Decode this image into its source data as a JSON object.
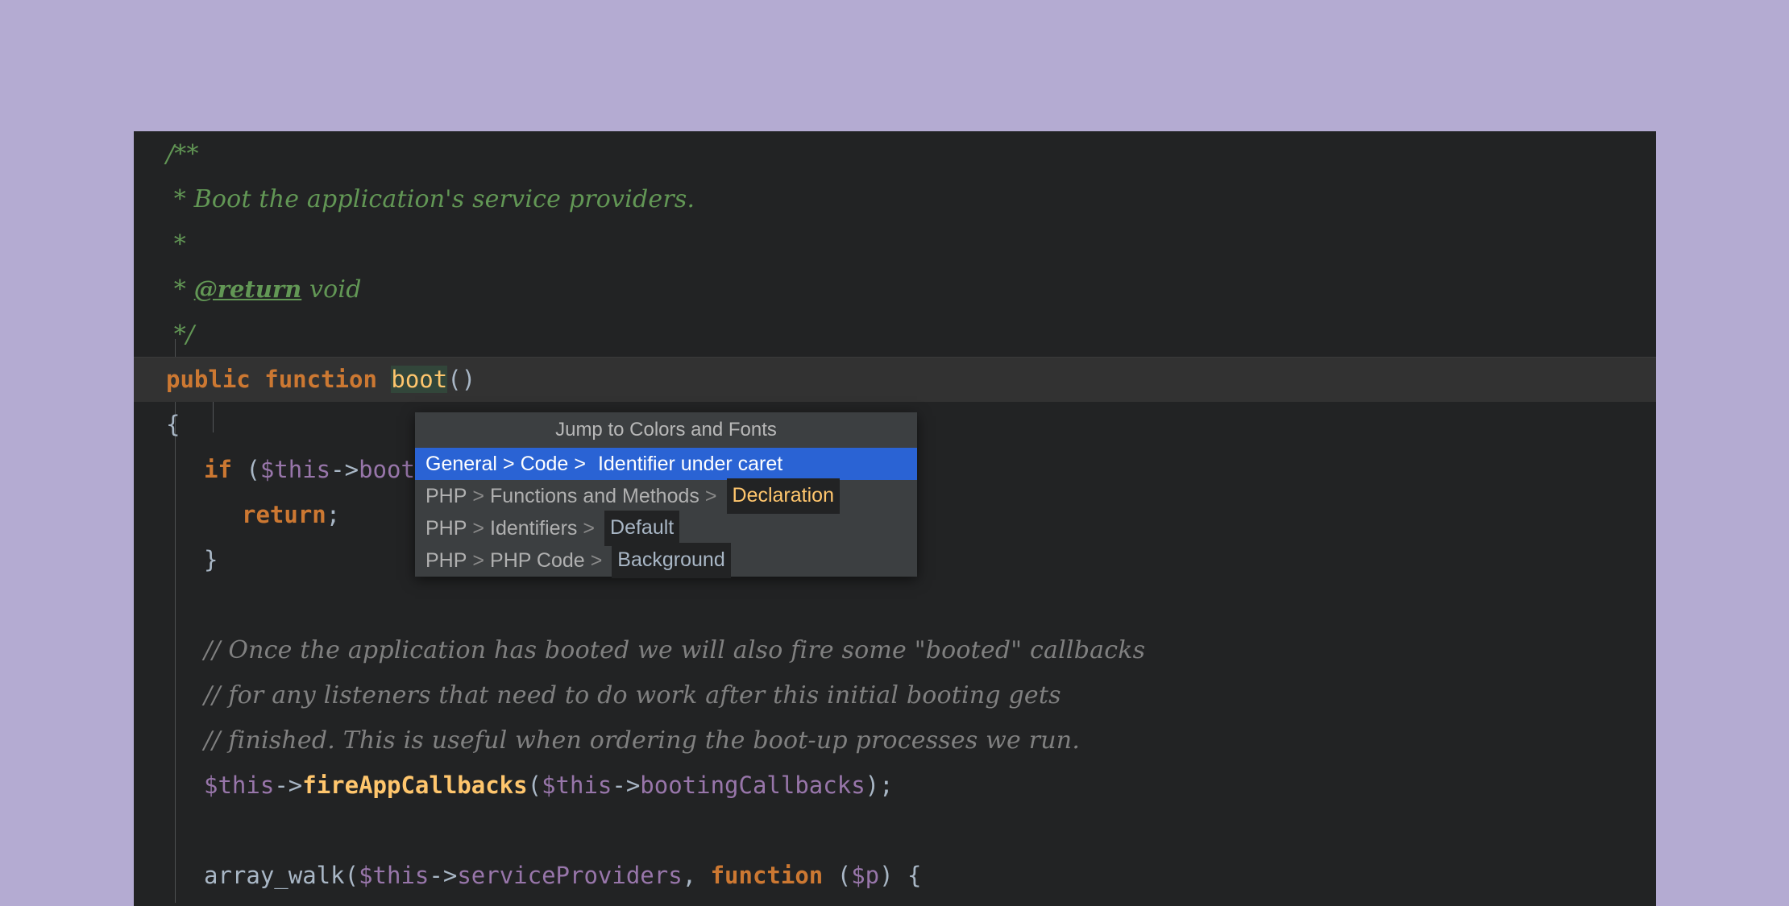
{
  "window": {
    "background_color": "#b4abd2",
    "editor_background": "#222324",
    "caret_line_background": "#323232"
  },
  "editor": {
    "lines": [
      {
        "id": "l1",
        "indent": 0,
        "type": "doc",
        "text": "/**"
      },
      {
        "id": "l2",
        "indent": 0,
        "type": "doc",
        "text": " * Boot the application's service providers."
      },
      {
        "id": "l3",
        "indent": 0,
        "type": "doc",
        "text": " *"
      },
      {
        "id": "l4",
        "indent": 0,
        "type": "doc",
        "prefix": " * ",
        "tag": "@return",
        "suffix": " void"
      },
      {
        "id": "l5",
        "indent": 0,
        "type": "doc",
        "text": " */"
      },
      {
        "id": "l6",
        "indent": 0,
        "type": "code",
        "caret": true,
        "tokens": [
          {
            "t": "public",
            "c": "kw"
          },
          {
            "t": " ",
            "c": "plain"
          },
          {
            "t": "function",
            "c": "kw"
          },
          {
            "t": " ",
            "c": "plain"
          },
          {
            "t": "boot",
            "c": "fn-decl",
            "highlight": true
          },
          {
            "t": "()",
            "c": "punct"
          }
        ]
      },
      {
        "id": "l7",
        "indent": 0,
        "type": "code",
        "tokens": [
          {
            "t": "{",
            "c": "punct"
          }
        ]
      },
      {
        "id": "l8",
        "indent": 1,
        "type": "code",
        "tokens": [
          {
            "t": "if",
            "c": "kw"
          },
          {
            "t": " (",
            "c": "punct"
          },
          {
            "t": "$this",
            "c": "var"
          },
          {
            "t": "->",
            "c": "op"
          },
          {
            "t": "booted",
            "c": "var"
          },
          {
            "t": ") {",
            "c": "punct"
          }
        ]
      },
      {
        "id": "l9",
        "indent": 2,
        "type": "code",
        "tokens": [
          {
            "t": "return",
            "c": "kw"
          },
          {
            "t": ";",
            "c": "punct"
          }
        ]
      },
      {
        "id": "l10",
        "indent": 1,
        "type": "code",
        "tokens": [
          {
            "t": "}",
            "c": "punct"
          }
        ]
      },
      {
        "id": "l11",
        "indent": 0,
        "type": "blank",
        "text": ""
      },
      {
        "id": "l12",
        "indent": 1,
        "type": "cmt",
        "text": "// Once the application has booted we will also fire some \"booted\" callbacks"
      },
      {
        "id": "l13",
        "indent": 1,
        "type": "cmt",
        "text": "// for any listeners that need to do work after this initial booting gets"
      },
      {
        "id": "l14",
        "indent": 1,
        "type": "cmt",
        "text": "// finished. This is useful when ordering the boot-up processes we run."
      },
      {
        "id": "l15",
        "indent": 1,
        "type": "code",
        "tokens": [
          {
            "t": "$this",
            "c": "var"
          },
          {
            "t": "->",
            "c": "op"
          },
          {
            "t": "fireAppCallbacks",
            "c": "fn-call"
          },
          {
            "t": "(",
            "c": "punct"
          },
          {
            "t": "$this",
            "c": "var"
          },
          {
            "t": "->",
            "c": "op"
          },
          {
            "t": "bootingCallbacks",
            "c": "var"
          },
          {
            "t": ");",
            "c": "punct"
          }
        ]
      },
      {
        "id": "l16",
        "indent": 0,
        "type": "blank",
        "text": ""
      },
      {
        "id": "l17",
        "indent": 1,
        "type": "code",
        "tokens": [
          {
            "t": "array_walk",
            "c": "plain"
          },
          {
            "t": "(",
            "c": "punct"
          },
          {
            "t": "$this",
            "c": "var"
          },
          {
            "t": "->",
            "c": "op"
          },
          {
            "t": "serviceProviders",
            "c": "var"
          },
          {
            "t": ", ",
            "c": "punct"
          },
          {
            "t": "function",
            "c": "kw"
          },
          {
            "t": " (",
            "c": "punct"
          },
          {
            "t": "$p",
            "c": "var"
          },
          {
            "t": ") {",
            "c": "punct"
          }
        ]
      }
    ]
  },
  "popup": {
    "title": "Jump to Colors and Fonts",
    "items": [
      {
        "selected": true,
        "path": [
          "General",
          "Code"
        ],
        "leaf": "Identifier under caret",
        "leaf_style": "selected"
      },
      {
        "selected": false,
        "path": [
          "PHP",
          "Functions and Methods"
        ],
        "leaf": "Declaration",
        "leaf_style": "declaration"
      },
      {
        "selected": false,
        "path": [
          "PHP",
          "Identifiers"
        ],
        "leaf": "Default",
        "leaf_style": "default"
      },
      {
        "selected": false,
        "path": [
          "PHP",
          "PHP Code"
        ],
        "leaf": "Background",
        "leaf_style": "background"
      }
    ],
    "separator": ">",
    "colors": {
      "background": "#3c3f41",
      "selected_background": "#2a63d4",
      "text": "#9a9a9a",
      "selected_text": "#ffffff",
      "declaration_color": "#ffc66d",
      "chip_background": "#222324"
    }
  }
}
